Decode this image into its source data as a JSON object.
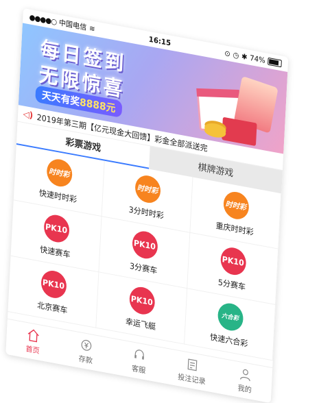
{
  "status": {
    "carrier": "中国电信",
    "time": "16:15",
    "battery": "74%"
  },
  "banner": {
    "line1": "每日签到",
    "line2": "无限惊喜",
    "prize_prefix": "天天有奖",
    "prize_amount": "8888元"
  },
  "notice": {
    "text": "2019年第三期【亿元现金大回馈】彩金全部派送完"
  },
  "tabs": [
    {
      "label": "彩票游戏"
    },
    {
      "label": "棋牌游戏"
    }
  ],
  "games": [
    {
      "label": "快速时时彩",
      "icon": "orange",
      "icon_text": "时时彩"
    },
    {
      "label": "3分时时彩",
      "icon": "orange",
      "icon_text": "时时彩"
    },
    {
      "label": "重庆时时彩",
      "icon": "orange",
      "icon_text": "时时彩"
    },
    {
      "label": "快速赛车",
      "icon": "red",
      "icon_text": "PK10"
    },
    {
      "label": "3分赛车",
      "icon": "red",
      "icon_text": "PK10"
    },
    {
      "label": "5分赛车",
      "icon": "red",
      "icon_text": "PK10"
    },
    {
      "label": "北京赛车",
      "icon": "red",
      "icon_text": "PK10"
    },
    {
      "label": "幸运飞艇",
      "icon": "red",
      "icon_text": "PK10"
    },
    {
      "label": "快速六合彩",
      "icon": "green",
      "icon_text": "六合彩"
    }
  ],
  "nav": [
    {
      "label": "首页",
      "icon": "home-icon"
    },
    {
      "label": "存款",
      "icon": "deposit-icon"
    },
    {
      "label": "客服",
      "icon": "service-icon"
    },
    {
      "label": "投注记录",
      "icon": "record-icon"
    },
    {
      "label": "我的",
      "icon": "user-icon"
    }
  ],
  "colors": {
    "accent": "#e8354f",
    "orange": "#f7841f",
    "green": "#28b487",
    "blue": "#2f7ce0"
  }
}
